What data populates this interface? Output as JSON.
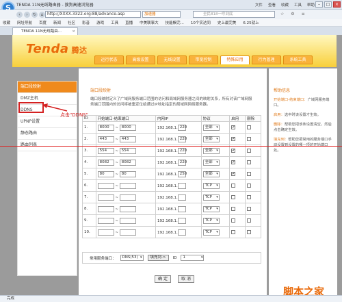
{
  "browser": {
    "title": "TENDA 11N无线路由器 - 搜狗高速浏览器",
    "menus": [
      "文件",
      "查看",
      "收藏",
      "工具",
      "帮助"
    ],
    "url": "http://XXXX.3322.org:88/advance.asp",
    "url_extra": "加速器",
    "search_placeholder": "全民818一呼到底",
    "favorites": [
      "收藏",
      "网址导航",
      "百度",
      "新闻",
      "社区",
      "影音",
      "游戏",
      "工具",
      "直播",
      "中美联事大",
      "技能帳完...",
      "10个实达同",
      "史上最完美",
      "6.25就上"
    ],
    "tab_label": "TENDA 11N无线路由...",
    "status": "完成"
  },
  "router": {
    "brand": "Tenda",
    "brand_cn": "腾达",
    "nav_tabs": [
      "运行状态",
      "高级设置",
      "无线设置",
      "带宽控制",
      "特殊应用",
      "行为管理",
      "系统工具"
    ],
    "active_tab_index": 4,
    "side_menu": [
      "端口段映射",
      "DMZ主机",
      "DDNS",
      "UPNP设置",
      "静态路由",
      "路由列表"
    ],
    "section_title": "端口段映射",
    "description": "端口段映射定义了广域网服务端口范围的访问和局域网服务器之间的映射关系，所有对该广域网服务端口范围内的访问将被重定位给通过IP地址指定的局域网网络服务器。",
    "table_headers": [
      "ID",
      "开始端口-结束端口",
      "内网IP",
      "协议",
      "启用",
      "删除"
    ],
    "rows": [
      {
        "id": "1.",
        "start": "8000",
        "end": "8000",
        "ip": "192.168.1.",
        "ip_last": "220",
        "protocol": "全部",
        "enabled": "✔",
        "delete": ""
      },
      {
        "id": "2.",
        "start": "443",
        "end": "443",
        "ip": "192.168.1.",
        "ip_last": "220",
        "protocol": "全部",
        "enabled": "✔",
        "delete": ""
      },
      {
        "id": "3.",
        "start": "554",
        "end": "554",
        "ip": "192.168.1.",
        "ip_last": "220",
        "protocol": "全部",
        "enabled": "✔",
        "delete": ""
      },
      {
        "id": "4.",
        "start": "8082",
        "end": "8082",
        "ip": "192.168.1.",
        "ip_last": "220",
        "protocol": "全部",
        "enabled": "✔",
        "delete": ""
      },
      {
        "id": "5.",
        "start": "80",
        "end": "80",
        "ip": "192.168.1.",
        "ip_last": "250",
        "protocol": "全部",
        "enabled": "✔",
        "delete": ""
      },
      {
        "id": "6.",
        "start": "",
        "end": "",
        "ip": "192.168.1.",
        "ip_last": "",
        "protocol": "TCP",
        "enabled": "",
        "delete": ""
      },
      {
        "id": "7.",
        "start": "",
        "end": "",
        "ip": "192.168.1.",
        "ip_last": "",
        "protocol": "TCP",
        "enabled": "",
        "delete": ""
      },
      {
        "id": "8.",
        "start": "",
        "end": "",
        "ip": "192.168.1.",
        "ip_last": "",
        "protocol": "TCP",
        "enabled": "",
        "delete": ""
      },
      {
        "id": "9.",
        "start": "",
        "end": "",
        "ip": "192.168.1.",
        "ip_last": "",
        "protocol": "TCP",
        "enabled": "",
        "delete": ""
      },
      {
        "id": "10.",
        "start": "",
        "end": "",
        "ip": "192.168.1.",
        "ip_last": "",
        "protocol": "TCP",
        "enabled": "",
        "delete": ""
      }
    ],
    "common_ports_label": "常用服务端口：",
    "common_ports_value": "DNS(53)",
    "fill_to_label": "填充到->",
    "id_label": "ID",
    "id_value": "1",
    "ok_label": "确 定",
    "cancel_label": "取 消",
    "help_title": "帮助信息",
    "help_items": [
      {
        "key": "开始端口-结束端口：",
        "text": "广域网服务端口。"
      },
      {
        "key": "启用：",
        "text": "选中时该设置才生效。"
      },
      {
        "key": "删除：",
        "text": "帮助您把该条设置清空，然后点击确定生效。"
      },
      {
        "key": "填充到：",
        "text": "帮助您把常用的服务端口手动设置到设置的哪一项的开始端口处。"
      }
    ]
  },
  "annotation": {
    "text": "点击\"DDNS\"",
    "color": "#d42020"
  },
  "watermark": {
    "line1": "jb51.net",
    "line2": "脚本之家"
  }
}
